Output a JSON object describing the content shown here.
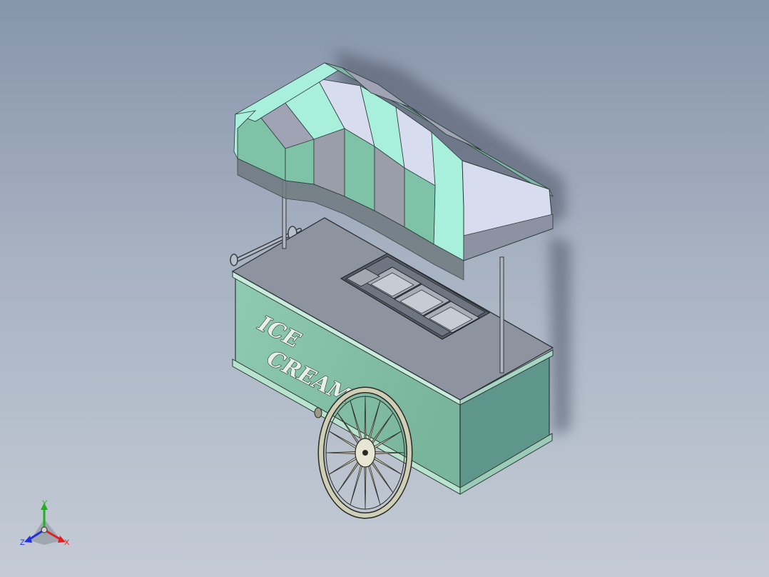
{
  "viewport": {
    "background_top": "#8795ab",
    "background_bottom": "#c4cbd5"
  },
  "model": {
    "subject": "ice-cream-cart",
    "lettering_line_1": "ICE",
    "lettering_line_2": "CREAM",
    "colors": {
      "body_mint": "#86c2a9",
      "body_end": "#5e968b",
      "top_gray": "#8e949f",
      "canopy_mint": "#a8efdc",
      "canopy_stripe_gray": "#9fa3b3",
      "canopy_light": "#d7dcef",
      "wheel": "#c9c9b0"
    }
  },
  "triad": {
    "x_label": "X",
    "y_label": "Y",
    "z_label": "Z",
    "x_color": "#e02020",
    "y_color": "#20b020",
    "z_color": "#2030e0"
  }
}
